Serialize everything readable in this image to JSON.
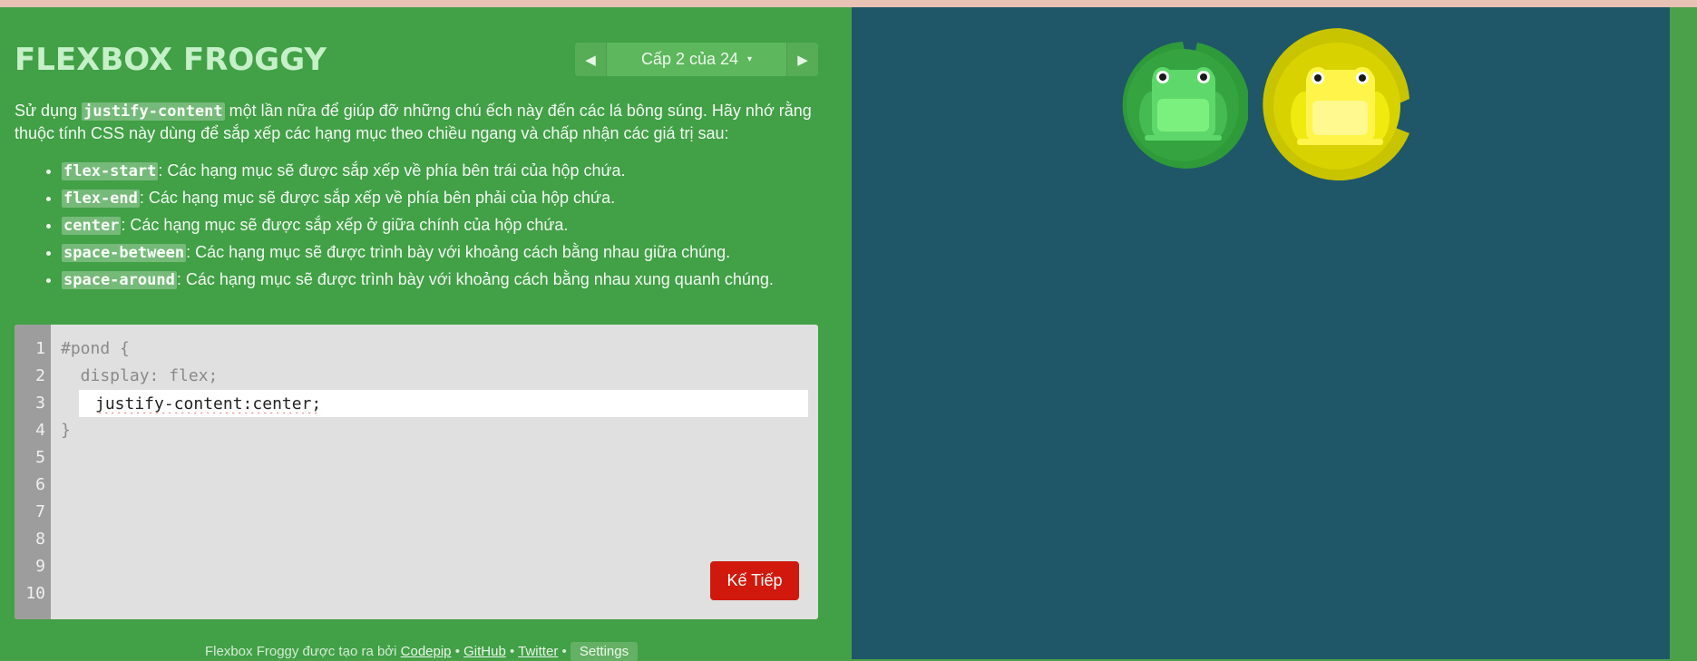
{
  "app": {
    "title": "FLEXBOX FROGGY"
  },
  "level_nav": {
    "prev_icon": "triangle-left-icon",
    "label": "Cấp 2 của 24",
    "caret": "▾",
    "next_icon": "triangle-right-icon"
  },
  "instructions": {
    "intro_before": "Sử dụng ",
    "intro_code": "justify-content",
    "intro_after": " một lần nữa để giúp đỡ những chú ếch này đến các lá bông súng. Hãy nhớ rằng thuộc tính CSS này dùng để sắp xếp các hạng mục theo chiều ngang và chấp nhận các giá trị sau:",
    "values": [
      {
        "code": "flex-start",
        "text": ": Các hạng mục sẽ được sắp xếp về phía bên trái của hộp chứa."
      },
      {
        "code": "flex-end",
        "text": ": Các hạng mục sẽ được sắp xếp về phía bên phải của hộp chứa."
      },
      {
        "code": "center",
        "text": ": Các hạng mục sẽ được sắp xếp ở giữa chính của hộp chứa."
      },
      {
        "code": "space-between",
        "text": ": Các hạng mục sẽ được trình bày với khoảng cách bằng nhau giữa chúng."
      },
      {
        "code": "space-around",
        "text": ": Các hạng mục sẽ được trình bày với khoảng cách bằng nhau xung quanh chúng."
      }
    ]
  },
  "editor": {
    "line_numbers": [
      "1",
      "2",
      "3",
      "4",
      "5",
      "6",
      "7",
      "8",
      "9",
      "10"
    ],
    "line1": "#pond {",
    "line2": "  display: flex;",
    "input_value": "justify-content:center;",
    "line4": "}",
    "next_button": "Kế Tiếp"
  },
  "footer": {
    "text": "Flexbox Froggy được tạo ra bởi ",
    "codepip": "Codepip",
    "sep1": " • ",
    "github": "GitHub",
    "sep2": " • ",
    "twitter": "Twitter",
    "sep3": " • ",
    "settings": "Settings"
  },
  "pond": {
    "frogs": [
      {
        "color": "green",
        "icon": "green-frog-icon",
        "lilypad": "green-lilypad-icon"
      },
      {
        "color": "yellow",
        "icon": "yellow-frog-icon",
        "lilypad": "yellow-lilypad-icon"
      }
    ],
    "colors": {
      "water": "#1f5768",
      "green_pad": "#2f9a3a",
      "yellow_pad": "#c9c400"
    }
  }
}
